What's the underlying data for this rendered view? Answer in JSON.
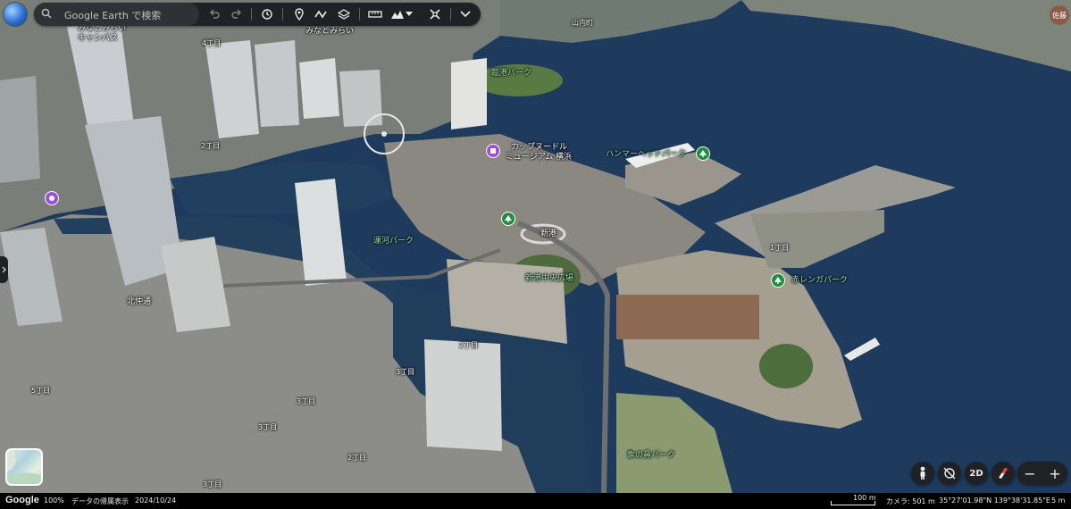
{
  "app": {
    "search_placeholder": "Google Earth で検索",
    "user_avatar_text": "佐藤"
  },
  "toolbar": {
    "icons": [
      "undo-icon",
      "redo-icon",
      "history-icon",
      "pin-icon",
      "path-icon",
      "layers-icon",
      "ruler-icon",
      "elevation-icon",
      "split-view-icon",
      "expand-icon"
    ]
  },
  "labels": {
    "minato_mirai": "みなとみらい",
    "minato_mirai_campus_1": "みなとみらい",
    "minato_mirai_campus_2": "キャンパス",
    "yamauchi_cho": "山内町",
    "rinko_park": "臨港パーク",
    "cupnoodle_1": "カップヌードル",
    "cupnoodle_2": "ミュージアム 横浜",
    "hammerhead": "ハンマーヘッドパーク",
    "unga_park": "運河パーク",
    "shinko": "新港",
    "shinko_central_square": "新港中央広場",
    "red_brick_park": "赤レンガパーク",
    "kitanaka_dori": "北仲通",
    "zo_no_hana_park": "象の鼻パーク",
    "chome_4": "4丁目",
    "chome_2_a": "2丁目",
    "chome_1": "1丁目",
    "chome_2_b": "2丁目",
    "chome_3_a": "3丁目",
    "chome_5": "5丁目",
    "chome_3_b": "3丁目",
    "chome_3_c": "3丁目",
    "chome_2_c": "2丁目",
    "chome_3_d": "3丁目"
  },
  "controls": {
    "view_2d_label": "2D",
    "zoom_in": "+",
    "zoom_out": "−"
  },
  "status": {
    "provider": "Google",
    "zoom": "100%",
    "data_attribution": "データの帰属表示",
    "date": "2024/10/24",
    "scale": "100 m",
    "camera": "カメラ: 501 m",
    "coordinates": "35°27'01.98\"N 139°38'31.85\"E",
    "altitude": "5 m"
  },
  "colors": {
    "water": "#1d3a5c",
    "toolbar_bg": "#202124",
    "park_label": "#9de3b0",
    "park_pin": "#1e8e3e",
    "museum_pin": "#9c4fd6"
  }
}
